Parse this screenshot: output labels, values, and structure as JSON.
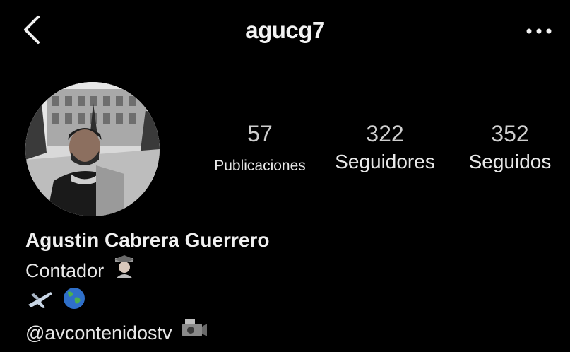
{
  "header": {
    "username": "agucg7",
    "back_icon": "chevron-left-icon",
    "more_icon": "more-horizontal-icon"
  },
  "stats": {
    "posts": {
      "count": "57",
      "label": "Publicaciones"
    },
    "followers": {
      "count": "322",
      "label": "Seguidores"
    },
    "following": {
      "count": "352",
      "label": "Seguidos"
    }
  },
  "bio": {
    "name": "Agustin Cabrera Guerrero",
    "occupation": "Contador",
    "occupation_emoji": "graduate-emoji-icon",
    "emojis": [
      "airplane-emoji-icon",
      "globe-emoji-icon"
    ],
    "handle": "@avcontenidostv",
    "handle_emoji": "video-camera-emoji-icon"
  },
  "colors": {
    "background": "#000000",
    "text": "#ffffff",
    "muted": "#cfcfcf"
  }
}
